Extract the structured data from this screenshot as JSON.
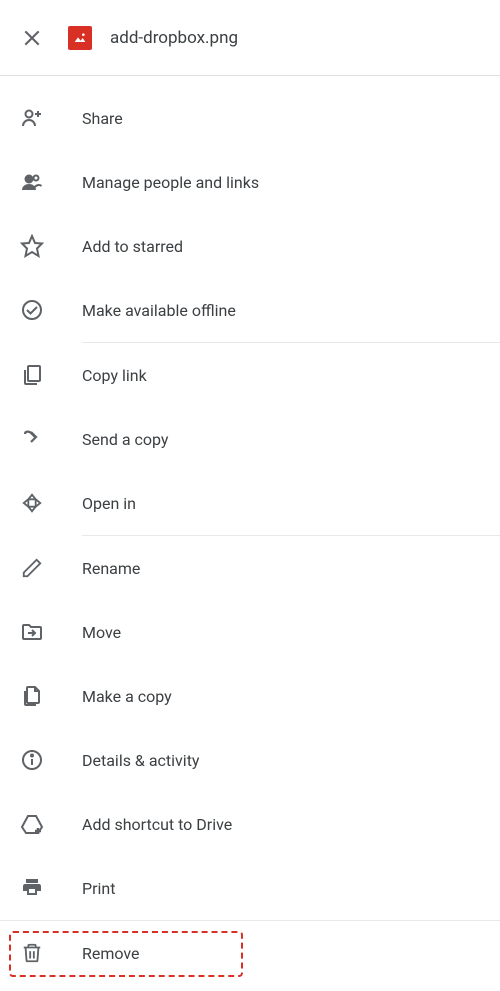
{
  "header": {
    "filename": "add-dropbox.png"
  },
  "menu": {
    "share": "Share",
    "manage": "Manage people and links",
    "starred": "Add to starred",
    "offline": "Make available offline",
    "copylink": "Copy link",
    "sendcopy": "Send a copy",
    "openin": "Open in",
    "rename": "Rename",
    "move": "Move",
    "makecopy": "Make a copy",
    "details": "Details & activity",
    "shortcut": "Add shortcut to Drive",
    "print": "Print",
    "remove": "Remove"
  }
}
